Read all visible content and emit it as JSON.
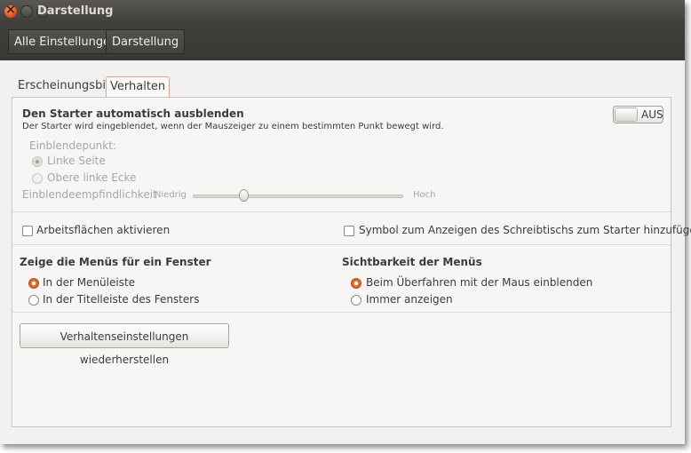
{
  "window": {
    "title": "Darstellung"
  },
  "toolbar": {
    "crumbs": [
      "Alle Einstellungen",
      "Darstellung"
    ]
  },
  "tabs": [
    {
      "label": "Erscheinungsbild",
      "active": false
    },
    {
      "label": "Verhalten",
      "active": true
    }
  ],
  "launcher": {
    "heading": "Den Starter automatisch ausblenden",
    "description": "Der Starter wird eingeblendet, wenn der Mauszeiger zu einem bestimmten Punkt bewegt wird.",
    "switch_label": "AUS",
    "reveal_label": "Einblendepunkt:",
    "reveal_options": [
      "Linke Seite",
      "Obere linke Ecke"
    ],
    "reveal_selected": 0,
    "sensitivity_label": "Einblendeempfindlichkeit",
    "sensitivity_low": "Niedrig",
    "sensitivity_high": "Hoch",
    "sensitivity_value": 0.24
  },
  "checks": {
    "workspaces": "Arbeitsflächen aktivieren",
    "desktop_icon": "Symbol zum Anzeigen des Schreibtischs zum Starter hinzufügen"
  },
  "menus": {
    "heading": "Zeige die Menüs für ein Fenster",
    "options": [
      "In der Menüleiste",
      "In der Titelleiste des Fensters"
    ],
    "selected": 0
  },
  "visibility": {
    "heading": "Sichtbarkeit der Menüs",
    "options": [
      "Beim Überfahren mit der Maus einblenden",
      "Immer anzeigen"
    ],
    "selected": 0
  },
  "reset_button": "Verhaltenseinstellungen wiederherstellen",
  "colors": {
    "accent": "#dd4814",
    "titlebar": "#3c3b37"
  }
}
